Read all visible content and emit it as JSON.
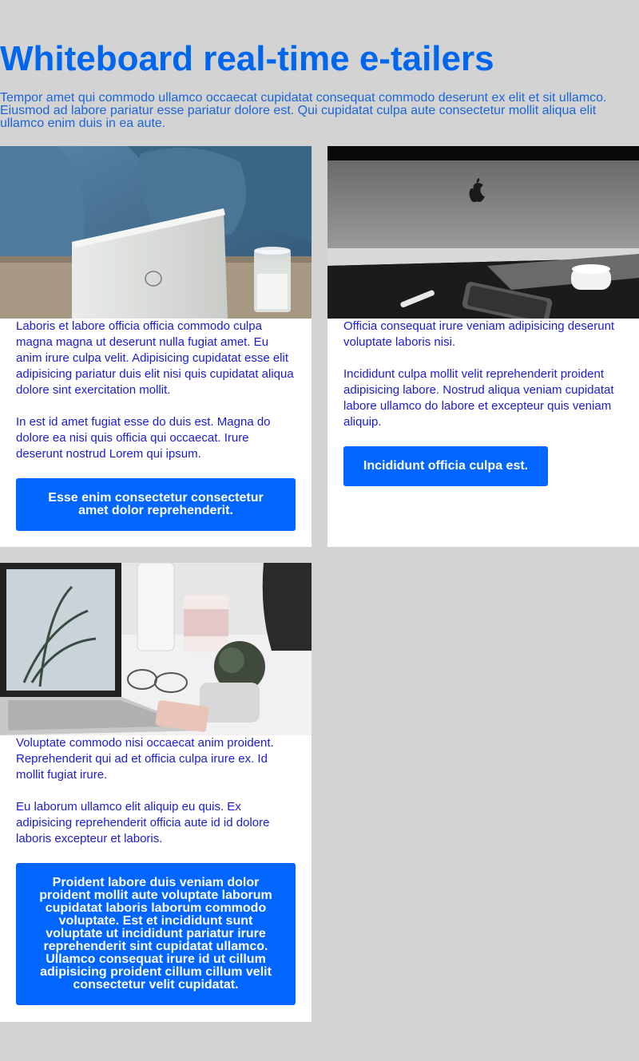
{
  "header": {
    "title": "Whiteboard real-time e-tailers",
    "intro": "Tempor amet qui commodo ullamco occaecat cupidatat consequat commodo deserunt ex elit et sit ullamco. Eiusmod ad labore pariatur esse pariatur dolore est. Qui cupidatat culpa aute consectetur mollit aliqua elit ullamco enim duis in ea aute."
  },
  "cards": [
    {
      "image": "laptop-on-table-photo",
      "paragraphs": [
        "Laboris et labore officia officia commodo culpa magna magna ut deserunt nulla fugiat amet. Eu anim irure culpa velit. Adipisicing cupidatat esse elit adipisicing pariatur duis elit nisi quis cupidatat aliqua dolore sint exercitation mollit.",
        "In est id amet fugiat esse do duis est. Magna do dolore ea nisi quis officia qui occaecat. Irure deserunt nostrud Lorem qui ipsum."
      ],
      "button_label": "Esse enim consectetur consectetur amet dolor reprehenderit."
    },
    {
      "image": "desktop-computer-with-phone-photo",
      "paragraphs": [
        "Officia consequat irure veniam adipisicing deserunt voluptate laboris nisi.",
        "Incididunt culpa mollit velit reprehenderit proident adipisicing labore. Nostrud aliqua veniam cupidatat labore ullamco do labore et excepteur quis veniam aliquip."
      ],
      "button_label": "Incididunt officia culpa est."
    },
    {
      "image": "laptop-with-plant-and-coffee-photo",
      "paragraphs": [
        "Voluptate commodo nisi occaecat anim proident. Reprehenderit qui ad et officia culpa irure ex. Id mollit fugiat irure.",
        "Eu laborum ullamco elit aliquip eu quis. Ex adipisicing reprehenderit officia aute id id dolore laboris excepteur et laboris."
      ],
      "button_label": "Proident labore duis veniam dolor proident mollit aute voluptate laborum cupidatat laboris laborum commodo voluptate. Est et incididunt sunt voluptate ut incididunt pariatur irure reprehenderit sint cupidatat ullamco. Ullamco consequat irure id ut cillum adipisicing proident cillum cillum velit consectetur velit cupidatat."
    }
  ],
  "colors": {
    "page_background": "#d3d3d3",
    "title": "#0066ee",
    "body_text": "#1a1ad9",
    "button": "#0066ff",
    "button_text": "#ffffff",
    "card_background": "#ffffff"
  }
}
